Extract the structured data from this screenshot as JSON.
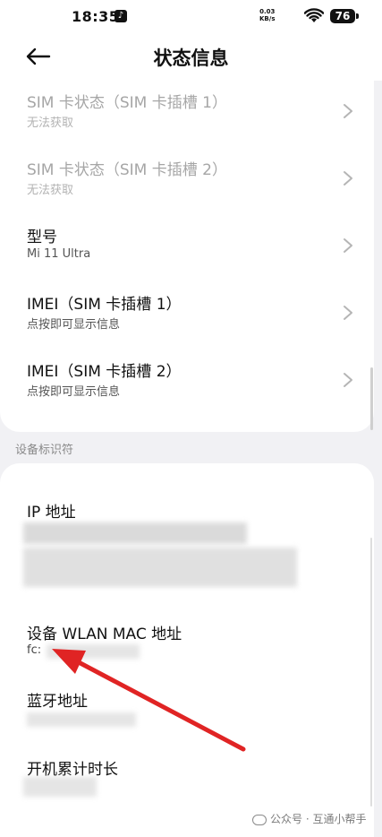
{
  "status_bar": {
    "time": "18:35",
    "net_speed_value": "0.03",
    "net_speed_unit": "KB/s",
    "battery": "76",
    "icons": [
      "tiktok-icon",
      "wifi-icon",
      "battery-icon"
    ]
  },
  "header": {
    "title": "状态信息",
    "back_icon": "arrow-left-icon"
  },
  "info_rows": [
    {
      "title": "SIM 卡状态（SIM 卡插槽 1）",
      "subtitle": "无法获取",
      "disabled": true
    },
    {
      "title": "SIM 卡状态（SIM 卡插槽 2）",
      "subtitle": "无法获取",
      "disabled": true
    },
    {
      "title": "型号",
      "subtitle": "Mi 11 Ultra",
      "disabled": false
    },
    {
      "title": "IMEI（SIM 卡插槽 1）",
      "subtitle": "点按即可显示信息",
      "disabled": false
    },
    {
      "title": "IMEI（SIM 卡插槽 2）",
      "subtitle": "点按即可显示信息",
      "disabled": false
    }
  ],
  "section": {
    "label": "设备标识符"
  },
  "identifiers": {
    "ip": {
      "title": "IP 地址"
    },
    "wlan_mac": {
      "title": "设备 WLAN MAC 地址",
      "value_visible": "fc:"
    },
    "bluetooth": {
      "title": "蓝牙地址"
    },
    "uptime": {
      "title": "开机累计时长"
    }
  },
  "annotation": {
    "color": "#e02424",
    "icon": "red-arrow-pointer"
  },
  "watermark": {
    "text": "公众号 · 互通小帮手"
  }
}
